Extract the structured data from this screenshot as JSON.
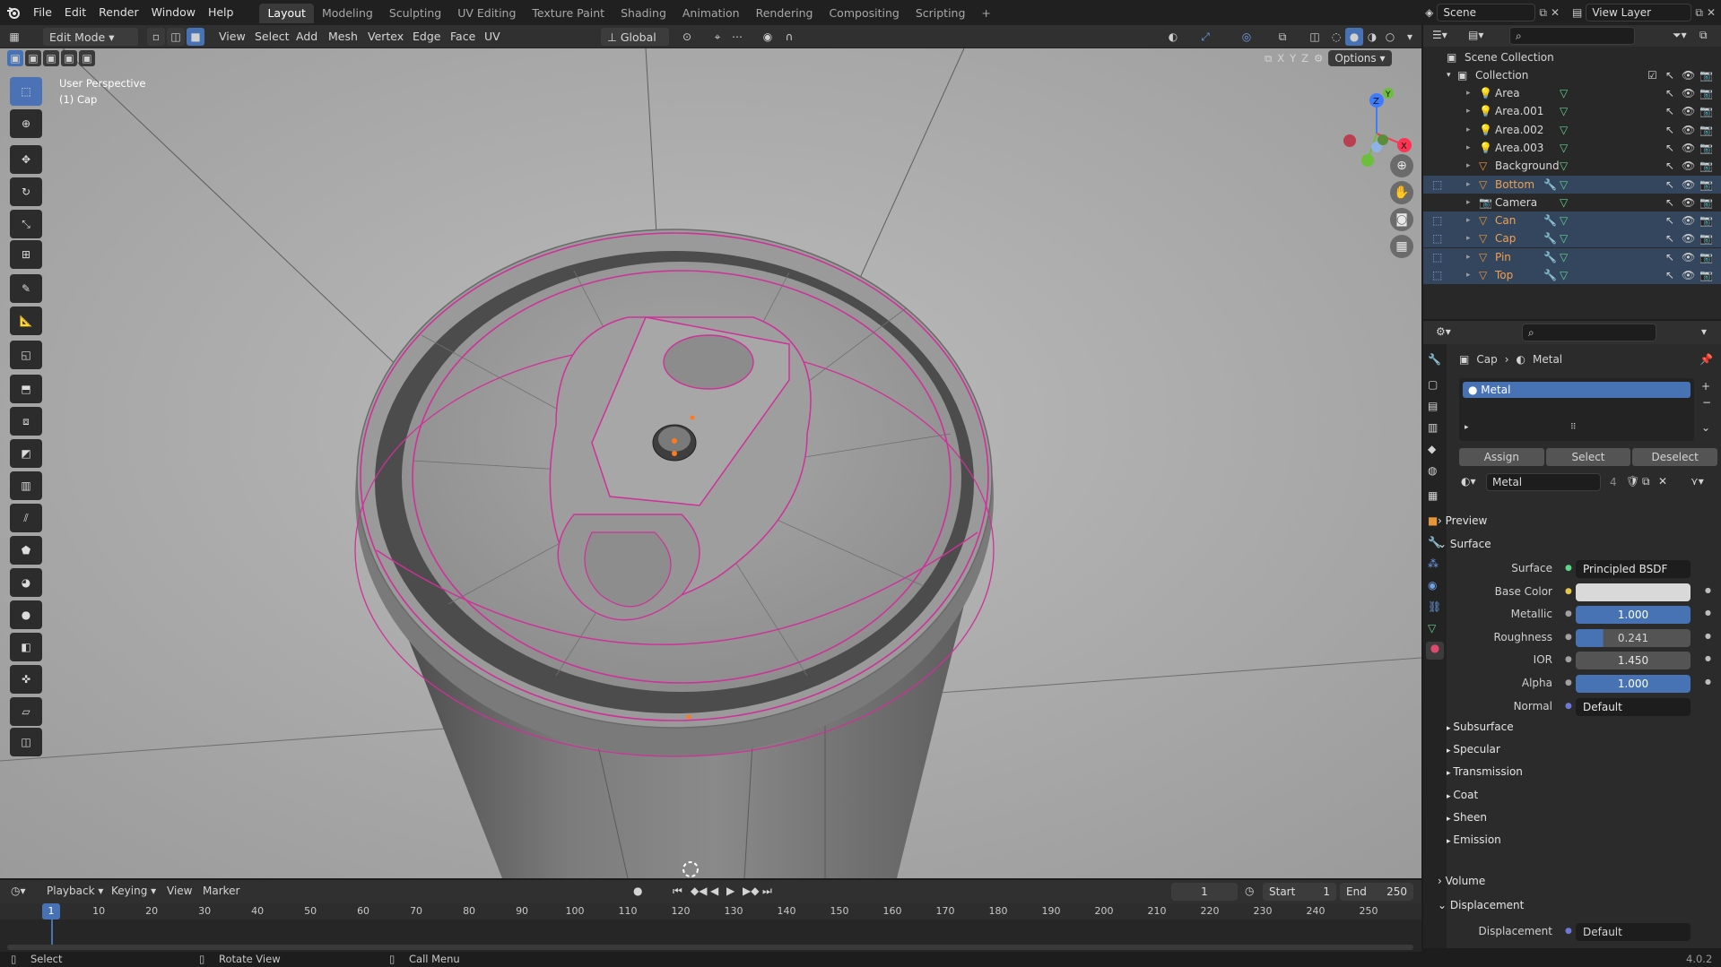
{
  "app": {
    "version": "4.0.2"
  },
  "topbar": {
    "menus": [
      "File",
      "Edit",
      "Render",
      "Window",
      "Help"
    ],
    "workspaces": [
      "Layout",
      "Modeling",
      "Sculpting",
      "UV Editing",
      "Texture Paint",
      "Shading",
      "Animation",
      "Rendering",
      "Compositing",
      "Scripting"
    ],
    "active_workspace": "Layout",
    "add_tab": "+",
    "scene": "Scene",
    "view_layer": "View Layer"
  },
  "viewport_header": {
    "mode": "Edit Mode",
    "menus": [
      "View",
      "Select",
      "Add",
      "Mesh",
      "Vertex",
      "Edge",
      "Face",
      "UV"
    ],
    "orientation": "Global",
    "axes": [
      "X",
      "Y",
      "Z"
    ],
    "options": "Options"
  },
  "viewport": {
    "view_name": "User Perspective",
    "object_name": "(1) Cap",
    "gizmo": {
      "x": "X",
      "y": "Y",
      "z": "Z"
    }
  },
  "outliner": {
    "root": "Scene Collection",
    "collection": "Collection",
    "items": [
      {
        "name": "Area",
        "kind": "light"
      },
      {
        "name": "Area.001",
        "kind": "light"
      },
      {
        "name": "Area.002",
        "kind": "light"
      },
      {
        "name": "Area.003",
        "kind": "light"
      },
      {
        "name": "Background",
        "kind": "mesh"
      },
      {
        "name": "Bottom",
        "kind": "mesh"
      },
      {
        "name": "Camera",
        "kind": "camera"
      },
      {
        "name": "Can",
        "kind": "mesh"
      },
      {
        "name": "Cap",
        "kind": "mesh"
      },
      {
        "name": "Pin",
        "kind": "mesh"
      },
      {
        "name": "Top",
        "kind": "mesh"
      }
    ]
  },
  "properties": {
    "breadcrumb": {
      "object": "Cap",
      "material": "Metal"
    },
    "slot": "Metal",
    "slot_buttons": {
      "assign": "Assign",
      "select": "Select",
      "deselect": "Deselect"
    },
    "material_name": "Metal",
    "users": "4",
    "sections": {
      "preview": "Preview",
      "surface": "Surface",
      "volume": "Volume",
      "displacement": "Displacement"
    },
    "surface_fields": [
      {
        "label": "Surface",
        "value": "Principled BSDF"
      },
      {
        "label": "Base Color",
        "value": ""
      },
      {
        "label": "Metallic",
        "value": "1.000"
      },
      {
        "label": "Roughness",
        "value": "0.241"
      },
      {
        "label": "IOR",
        "value": "1.450"
      },
      {
        "label": "Alpha",
        "value": "1.000"
      },
      {
        "label": "Normal",
        "value": "Default"
      }
    ],
    "subpanels": [
      "Subsurface",
      "Specular",
      "Transmission",
      "Coat",
      "Sheen",
      "Emission"
    ],
    "displacement_field": {
      "label": "Displacement",
      "value": "Default"
    }
  },
  "timeline": {
    "menus": [
      "Playback",
      "Keying",
      "View",
      "Marker"
    ],
    "current_frame": "1",
    "start_label": "Start",
    "start": "1",
    "end_label": "End",
    "end": "250",
    "ticks": [
      "10",
      "20",
      "30",
      "40",
      "50",
      "60",
      "70",
      "80",
      "90",
      "100",
      "110",
      "120",
      "130",
      "140",
      "150",
      "160",
      "170",
      "180",
      "190",
      "200",
      "210",
      "220",
      "230",
      "240",
      "250"
    ]
  },
  "statusbar": {
    "select": "Select",
    "rotate": "Rotate View",
    "call_menu": "Call Menu"
  }
}
